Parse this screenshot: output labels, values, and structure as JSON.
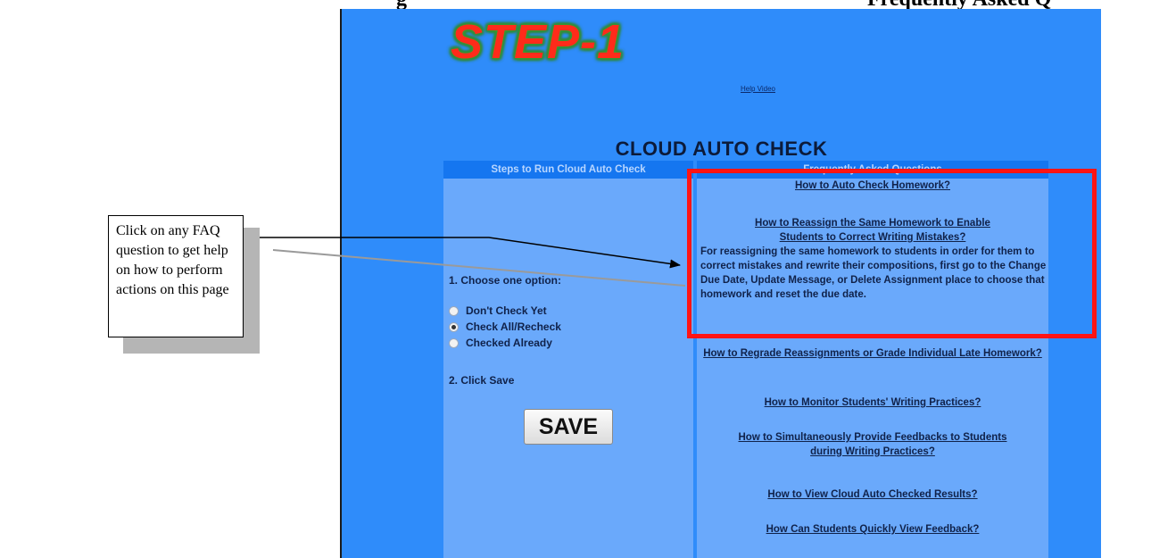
{
  "top_heading": {
    "left": "g",
    "right": "Frequently Asked Q"
  },
  "app": {
    "logo": "STEP-1",
    "help_video": "Help Video",
    "title": "CLOUD AUTO CHECK"
  },
  "columns": {
    "left_header": "Steps to Run Cloud Auto Check",
    "right_header": "Frequently Asked Questions"
  },
  "steps": {
    "step1_label": "1. Choose one option:",
    "options": [
      {
        "label": "Don't Check Yet",
        "checked": false
      },
      {
        "label": "Check All/Recheck",
        "checked": true
      },
      {
        "label": "Checked Already",
        "checked": false
      }
    ],
    "step2_label": "2. Click Save",
    "save_label": "SAVE"
  },
  "faq": {
    "items": [
      "How to Auto Check Homework?",
      "How to Reassign the Same Homework to Enable Students to Correct Writing Mistakes?",
      "How to Regrade Reassignments or Grade Individual Late Homework?",
      "How to Monitor Students' Writing Practices?",
      "How to Simultaneously Provide Feedbacks to Students during Writing Practices?",
      "How to View Cloud Auto Checked Results?",
      "How Can Students Quickly View Feedback?"
    ],
    "answer": "For reassigning the same homework to students in order for them to correct mistakes and rewrite their compositions, first go to the Change Due Date, Update Message, or Delete Assignment place to choose that homework and reset the due date."
  },
  "callout": {
    "text": "Click on any FAQ question to get help on how to perform actions on this page"
  },
  "colors": {
    "screen_bg": "#2f8cfa",
    "column_bg": "#6aa9fb",
    "header_bg": "#1576f0",
    "highlight": "#ff1414",
    "logo": "#ff2b1a"
  }
}
